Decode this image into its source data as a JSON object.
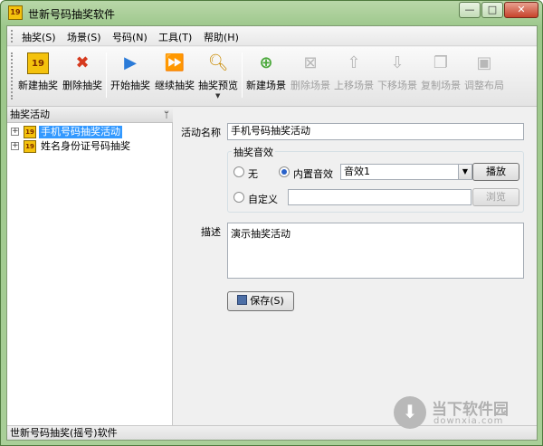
{
  "window": {
    "title": "世新号码抽奖软件",
    "app_icon": "lottery-app-icon",
    "controls": {
      "minimize": "—",
      "maximize": "□",
      "close": "✕"
    }
  },
  "menu": {
    "items": [
      "抽奖(S)",
      "场景(S)",
      "号码(N)",
      "工具(T)",
      "帮助(H)"
    ]
  },
  "toolbar": {
    "buttons": [
      {
        "label": "新建抽奖",
        "icon": "new-lottery-icon",
        "enabled": true
      },
      {
        "label": "删除抽奖",
        "icon": "delete-icon",
        "enabled": true
      },
      {
        "label": "开始抽奖",
        "icon": "play-icon",
        "enabled": true
      },
      {
        "label": "继续抽奖",
        "icon": "continue-icon",
        "enabled": true
      },
      {
        "label": "抽奖预览",
        "icon": "preview-search-icon",
        "enabled": true
      },
      {
        "label": "新建场景",
        "icon": "new-scene-icon",
        "enabled": true
      },
      {
        "label": "删除场景",
        "icon": "delete-scene-icon",
        "enabled": false
      },
      {
        "label": "上移场景",
        "icon": "move-up-icon",
        "enabled": false
      },
      {
        "label": "下移场景",
        "icon": "move-down-icon",
        "enabled": false
      },
      {
        "label": "复制场景",
        "icon": "copy-scene-icon",
        "enabled": false
      },
      {
        "label": "调整布局",
        "icon": "layout-icon",
        "enabled": false
      }
    ]
  },
  "left_pane": {
    "title": "抽奖活动",
    "pin_glyph": "ᛘ",
    "tree": [
      {
        "label": "手机号码抽奖活动",
        "selected": true
      },
      {
        "label": "姓名身份证号码抽奖",
        "selected": false
      }
    ]
  },
  "form": {
    "activity_name_label": "活动名称",
    "activity_name_value": "手机号码抽奖活动",
    "sound_group_label": "抽奖音效",
    "radio_none_label": "无",
    "radio_builtin_label": "内置音效",
    "builtin_selected": "音效1",
    "play_button": "播放",
    "radio_custom_label": "自定义",
    "custom_path_value": "",
    "browse_button": "浏览",
    "selected_sound_option": "builtin",
    "description_label": "描述",
    "description_value": "演示抽奖活动",
    "save_button": "保存(S)"
  },
  "status_bar": {
    "text": "世新号码抽奖(摇号)软件"
  },
  "watermark": {
    "text": "当下软件园",
    "sub": "downxia.com"
  }
}
